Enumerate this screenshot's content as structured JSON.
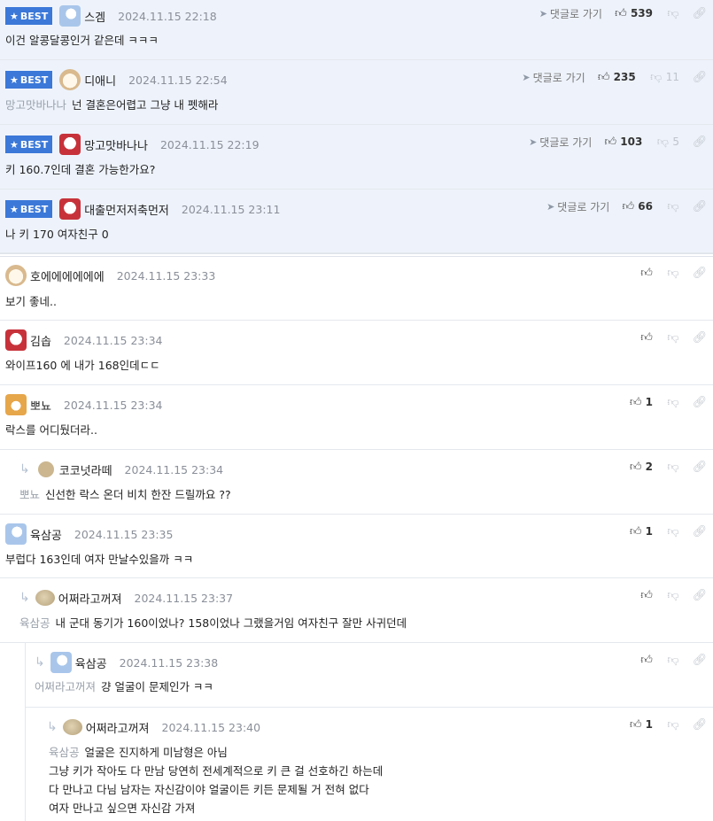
{
  "best_label": "BEST",
  "goto_label": "댓글로 가기",
  "comments": [
    {
      "nick": "스겜",
      "date": "2024.11.15 22:18",
      "text": "이건 알콩달콩인거 같은데 ㅋㅋㅋ",
      "likes": "539",
      "dislikes": ""
    },
    {
      "nick": "디애니",
      "date": "2024.11.15 22:54",
      "mention": "망고맛바나나",
      "text": "넌 결혼은어렵고 그냥 내 펫해라",
      "likes": "235",
      "dislikes": "11"
    },
    {
      "nick": "망고맛바나나",
      "date": "2024.11.15 22:19",
      "text": "키 160.7인데 결혼 가능한가요?",
      "likes": "103",
      "dislikes": "5"
    },
    {
      "nick": "대출먼저저축먼저",
      "date": "2024.11.15 23:11",
      "text": "나 키 170 여자친구 0",
      "likes": "66",
      "dislikes": ""
    },
    {
      "nick": "호에에에에에에",
      "date": "2024.11.15 23:33",
      "text": "보기 좋네..",
      "likes": ""
    },
    {
      "nick": "김솝",
      "date": "2024.11.15 23:34",
      "text": "와이프160 에 내가 168인데ㄷㄷ",
      "likes": ""
    },
    {
      "nick": "뽀뇨",
      "date": "2024.11.15 23:34",
      "text": "락스를 어디뒀더라..",
      "likes": "1"
    },
    {
      "nick": "코코넛라떼",
      "date": "2024.11.15 23:34",
      "mention": "뽀뇨",
      "text": "신선한 락스 온더 비치 한잔 드릴까요 ??",
      "likes": "2"
    },
    {
      "nick": "육삼공",
      "date": "2024.11.15 23:35",
      "text": "부럽다 163인데 여자 만날수있을까 ㅋㅋ",
      "likes": "1"
    },
    {
      "nick": "어쩌라고꺼져",
      "date": "2024.11.15 23:37",
      "mention": "육삼공",
      "text": "내 군대 동기가 160이었나? 158이었나 그랬을거임 여자친구 잘만 사귀던데",
      "likes": ""
    },
    {
      "nick": "육삼공",
      "date": "2024.11.15 23:38",
      "mention": "어쩌라고꺼져",
      "text": "걍 얼굴이 문제인가 ㅋㅋ",
      "likes": ""
    },
    {
      "nick": "어쩌라고꺼져",
      "date": "2024.11.15 23:40",
      "mention": "육삼공",
      "text": "얼굴은 진지하게 미남형은 아님",
      "lines": [
        "그냥 키가 작아도 다 만남 당연히 전세계적으로 키 큰 걸 선호하긴 하는데",
        "다 만나고 다님 남자는 자신감이야 얼굴이든 키든 문제될 거 전혀 없다",
        "여자 만나고 싶으면 자신감 가져"
      ],
      "likes": "1"
    }
  ]
}
